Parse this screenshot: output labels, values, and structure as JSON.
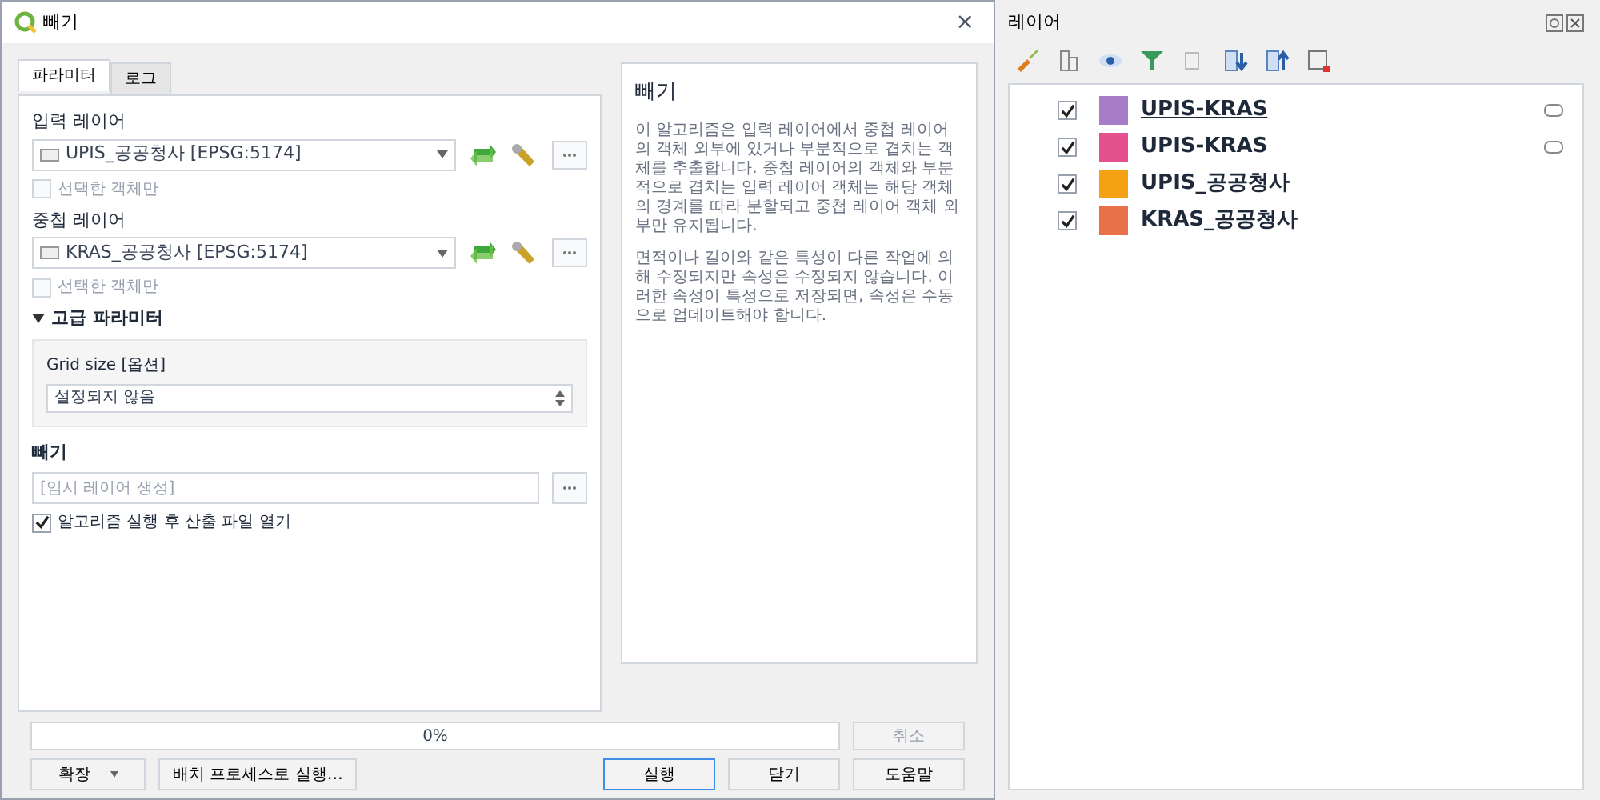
{
  "dialog": {
    "title": "빼기",
    "close": "×",
    "tabs": [
      {
        "label": "파라미터",
        "selected": true
      },
      {
        "label": "로그",
        "selected": false
      }
    ],
    "input_layer": {
      "label": "입력 레이어",
      "value": "UPIS_공공청사 [EPSG:5174]",
      "selected_only": {
        "label": "선택한 객체만",
        "checked": false,
        "disabled": true
      }
    },
    "overlay_layer": {
      "label": "중첩 레이어",
      "value": "KRAS_공공청사 [EPSG:5174]",
      "selected_only": {
        "label": "선택한 객체만",
        "checked": false,
        "disabled": true
      }
    },
    "advanced": {
      "label": "고급 파라미터",
      "expanded": true,
      "grid_size_label": "Grid size [옵션]",
      "grid_size_value": "설정되지 않음"
    },
    "output": {
      "label": "빼기",
      "placeholder": "[임시 레이어 생성]"
    },
    "open_output": {
      "label": "알고리즘 실행 후 산출 파일 열기",
      "checked": true
    },
    "help": {
      "title": "빼기",
      "paragraphs": [
        "이 알고리즘은 입력 레이어에서 중첩 레이어의 객체 외부에 있거나 부분적으로 겹치는 객체를 추출합니다. 중첩 레이어의 객체와 부분적으로 겹치는 입력 레이어 객체는 해당 객체의 경계를 따라 분할되고 중첩 레이어 객체 외부만 유지됩니다.",
        "면적이나 길이와 같은 특성이 다른 작업에 의해 수정되지만 속성은 수정되지 않습니다. 이러한 속성이 특성으로 저장되면, 속성은 수동으로 업데이트해야 합니다."
      ]
    },
    "progress": {
      "label": "0%",
      "level": 0
    },
    "cancel": {
      "label": "취소",
      "disabled": true
    },
    "advanced_button": "확장",
    "batch_button": "배치 프로세스로 실행…",
    "buttons": [
      {
        "label": "실행",
        "default": true
      },
      {
        "label": "닫기",
        "default": false
      },
      {
        "label": "도움말",
        "default": false
      }
    ]
  },
  "layers_panel": {
    "title": "레이어",
    "layers": [
      {
        "name": "UPIS-KRAS",
        "checked": true,
        "color": "#a77dc8",
        "current": true,
        "embedded": true
      },
      {
        "name": "UPIS-KRAS",
        "checked": true,
        "color": "#e5508f",
        "current": false,
        "embedded": true
      },
      {
        "name": "UPIS_공공청사",
        "checked": true,
        "color": "#f5a114",
        "current": false,
        "embedded": false
      },
      {
        "name": "KRAS_공공청사",
        "checked": true,
        "color": "#e8714a",
        "current": false,
        "embedded": false
      }
    ]
  }
}
